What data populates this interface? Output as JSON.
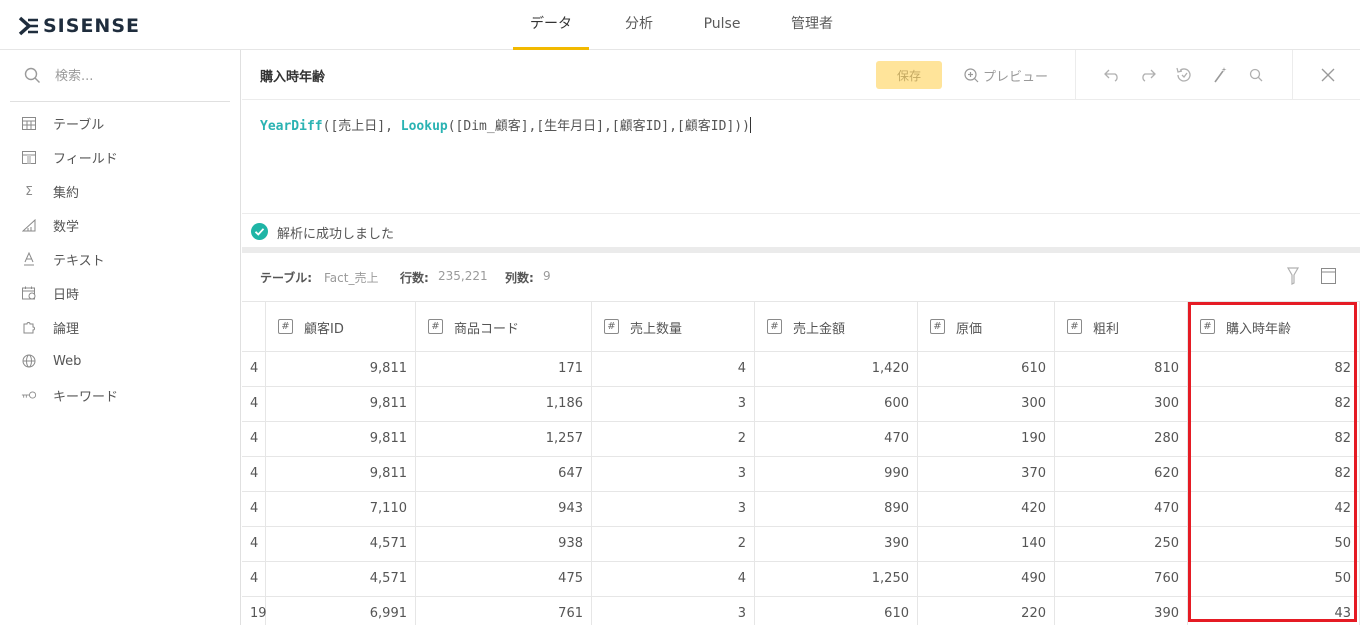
{
  "brand": {
    "logo_text": "SISENSE"
  },
  "nav": {
    "tabs": [
      "データ",
      "分析",
      "Pulse",
      "管理者"
    ],
    "active": "データ"
  },
  "sidebar": {
    "search_placeholder": "検索...",
    "items": [
      {
        "label": "テーブル",
        "icon": "table-icon"
      },
      {
        "label": "フィールド",
        "icon": "field-icon"
      },
      {
        "label": "集約",
        "icon": "sigma-icon"
      },
      {
        "label": "数学",
        "icon": "math-icon"
      },
      {
        "label": "テキスト",
        "icon": "text-icon"
      },
      {
        "label": "日時",
        "icon": "calendar-icon"
      },
      {
        "label": "論理",
        "icon": "puzzle-icon"
      },
      {
        "label": "Web",
        "icon": "globe-icon"
      },
      {
        "label": "キーワード",
        "icon": "key-icon"
      }
    ]
  },
  "editor": {
    "title": "購入時年齢",
    "save_label": "保存",
    "preview_label": "プレビュー",
    "formula": {
      "fn1": "YearDiff",
      "part1": "([売上日], ",
      "fn2": "Lookup",
      "part2": "([Dim_顧客],[生年月日],[顧客ID],[顧客ID]))"
    },
    "status_text": "解析に成功しました"
  },
  "table_info": {
    "table_label": "テーブル:",
    "table_name": "Fact_売上",
    "rows_label": "行数:",
    "rows_value": "235,221",
    "cols_label": "列数:",
    "cols_value": "9"
  },
  "grid": {
    "columns": [
      {
        "name": "",
        "type": ""
      },
      {
        "name": "顧客ID",
        "type": "#"
      },
      {
        "name": "商品コード",
        "type": "#"
      },
      {
        "name": "売上数量",
        "type": "#"
      },
      {
        "name": "売上金額",
        "type": "#"
      },
      {
        "name": "原価",
        "type": "#"
      },
      {
        "name": "粗利",
        "type": "#f"
      },
      {
        "name": "購入時年齢",
        "type": "#f"
      }
    ],
    "rows": [
      [
        "4",
        "9,811",
        "171",
        "4",
        "1,420",
        "610",
        "810",
        "82"
      ],
      [
        "4",
        "9,811",
        "1,186",
        "3",
        "600",
        "300",
        "300",
        "82"
      ],
      [
        "4",
        "9,811",
        "1,257",
        "2",
        "470",
        "190",
        "280",
        "82"
      ],
      [
        "4",
        "9,811",
        "647",
        "3",
        "990",
        "370",
        "620",
        "82"
      ],
      [
        "4",
        "7,110",
        "943",
        "3",
        "890",
        "420",
        "470",
        "42"
      ],
      [
        "4",
        "4,571",
        "938",
        "2",
        "390",
        "140",
        "250",
        "50"
      ],
      [
        "4",
        "4,571",
        "475",
        "4",
        "1,250",
        "490",
        "760",
        "50"
      ],
      [
        "19",
        "6,991",
        "761",
        "3",
        "610",
        "220",
        "390",
        "43"
      ]
    ]
  },
  "colors": {
    "accent": "#f2b900",
    "formula_fn": "#2ab3b3",
    "success": "#1fb5a6",
    "highlight": "#e51b24"
  }
}
